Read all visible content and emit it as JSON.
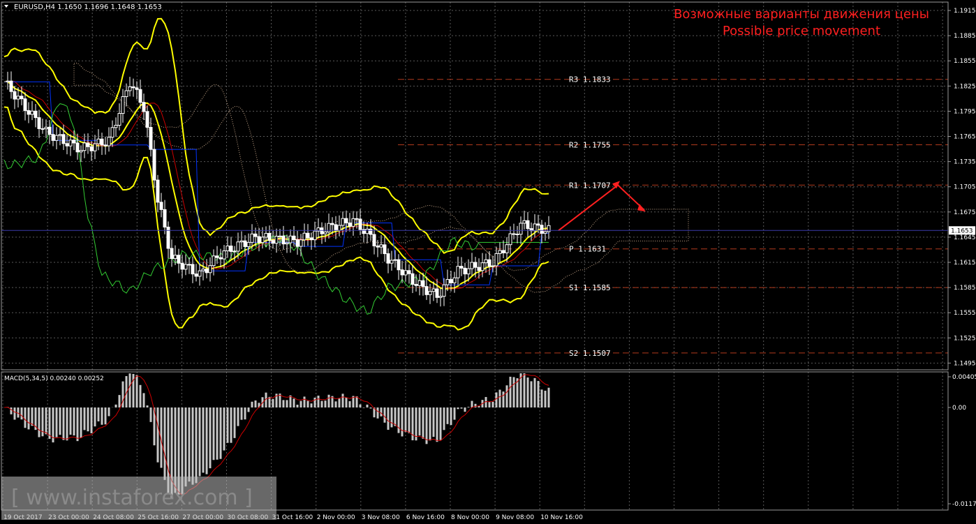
{
  "header": {
    "symbol_line": "EURUSD,H4  1.1650 1.1696 1.1648 1.1653",
    "annotation_ru": "Возможные варианты движения цены",
    "annotation_en": "Possible price movement"
  },
  "macd": {
    "label": "MACD(5,34,5) 0.00240 0.00252",
    "axis_ticks": [
      "0.00405",
      "0.00",
      "-0.01172"
    ]
  },
  "watermark": "[ www.instaforex.com ]",
  "colors": {
    "background": "#000000",
    "grid": "#5a5a5a",
    "candle": "#ffffff",
    "bollinger": "#ffff00",
    "ma_red": "#cc0000",
    "ma_blue": "#0033ff",
    "lagging_green": "#33cc33",
    "cloud": "#c8a88a",
    "pivot_line": "#b23a1d",
    "annotation": "#ff2020",
    "price_marker": "#6f6fff"
  },
  "chart_data": {
    "type": "candlestick",
    "symbol": "EURUSD",
    "timeframe": "H4",
    "ohlc": {
      "open": 1.165,
      "high": 1.1696,
      "low": 1.1648,
      "close": 1.1653
    },
    "current_price": "1.1653",
    "ylim": [
      1.1487,
      1.1925
    ],
    "y_ticks": [
      "1.1915",
      "1.1885",
      "1.1855",
      "1.1825",
      "1.1795",
      "1.1765",
      "1.1735",
      "1.1705",
      "1.1675",
      "1.1645",
      "1.1615",
      "1.1585",
      "1.1555",
      "1.1525",
      "1.1495"
    ],
    "x_ticks": [
      "19 Oct 2017",
      "23 Oct 00:00",
      "24 Oct 08:00",
      "25 Oct 16:00",
      "27 Oct 00:00",
      "30 Oct 08:00",
      "31 Oct 16:00",
      "2 Nov 00:00",
      "3 Nov 08:00",
      "6 Nov 16:00",
      "8 Nov 00:00",
      "9 Nov 08:00",
      "10 Nov 16:00"
    ],
    "pivot_levels": [
      {
        "label": "R3",
        "value": "1.1833"
      },
      {
        "label": "R2",
        "value": "1.1755"
      },
      {
        "label": "R1",
        "value": "1.1707"
      },
      {
        "label": "P",
        "value": "1.1631"
      },
      {
        "label": "S1",
        "value": "1.1585"
      },
      {
        "label": "S2",
        "value": "1.1507"
      }
    ],
    "forecast_path": [
      1.1653,
      1.1707,
      1.1678
    ]
  }
}
